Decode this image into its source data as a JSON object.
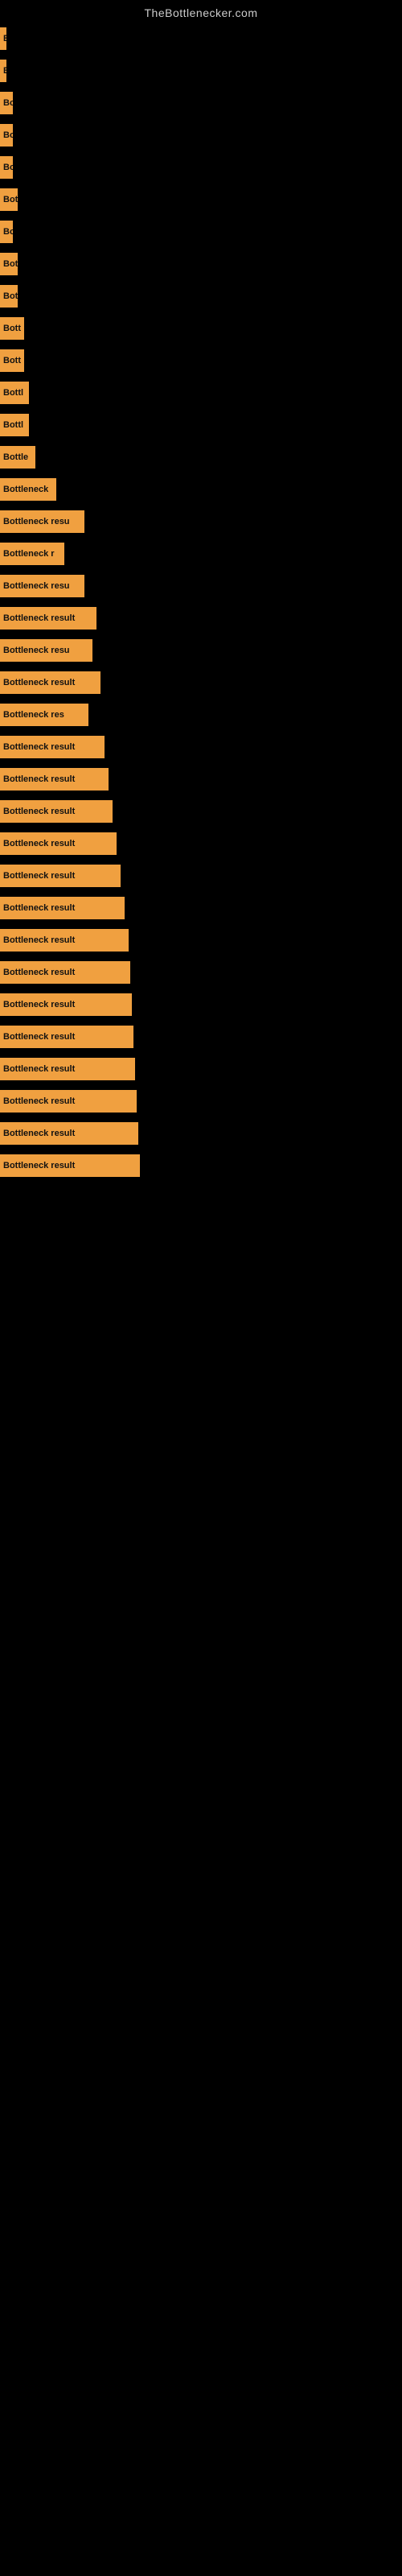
{
  "site_title": "TheBottlenecker.com",
  "bars": [
    {
      "id": 1,
      "label": "B",
      "width": 8
    },
    {
      "id": 2,
      "label": "B",
      "width": 8
    },
    {
      "id": 3,
      "label": "Bo",
      "width": 16
    },
    {
      "id": 4,
      "label": "Bo",
      "width": 16
    },
    {
      "id": 5,
      "label": "Bo",
      "width": 16
    },
    {
      "id": 6,
      "label": "Bot",
      "width": 22
    },
    {
      "id": 7,
      "label": "Bo",
      "width": 16
    },
    {
      "id": 8,
      "label": "Bot",
      "width": 22
    },
    {
      "id": 9,
      "label": "Bot",
      "width": 22
    },
    {
      "id": 10,
      "label": "Bott",
      "width": 30
    },
    {
      "id": 11,
      "label": "Bott",
      "width": 30
    },
    {
      "id": 12,
      "label": "Bottl",
      "width": 36
    },
    {
      "id": 13,
      "label": "Bottl",
      "width": 36
    },
    {
      "id": 14,
      "label": "Bottle",
      "width": 44
    },
    {
      "id": 15,
      "label": "Bottleneck",
      "width": 70
    },
    {
      "id": 16,
      "label": "Bottleneck resu",
      "width": 105
    },
    {
      "id": 17,
      "label": "Bottleneck r",
      "width": 80
    },
    {
      "id": 18,
      "label": "Bottleneck resu",
      "width": 105
    },
    {
      "id": 19,
      "label": "Bottleneck result",
      "width": 120
    },
    {
      "id": 20,
      "label": "Bottleneck resu",
      "width": 115
    },
    {
      "id": 21,
      "label": "Bottleneck result",
      "width": 125
    },
    {
      "id": 22,
      "label": "Bottleneck res",
      "width": 110
    },
    {
      "id": 23,
      "label": "Bottleneck result",
      "width": 130
    },
    {
      "id": 24,
      "label": "Bottleneck result",
      "width": 135
    },
    {
      "id": 25,
      "label": "Bottleneck result",
      "width": 140
    },
    {
      "id": 26,
      "label": "Bottleneck result",
      "width": 145
    },
    {
      "id": 27,
      "label": "Bottleneck result",
      "width": 150
    },
    {
      "id": 28,
      "label": "Bottleneck result",
      "width": 155
    },
    {
      "id": 29,
      "label": "Bottleneck result",
      "width": 160
    },
    {
      "id": 30,
      "label": "Bottleneck result",
      "width": 162
    },
    {
      "id": 31,
      "label": "Bottleneck result",
      "width": 164
    },
    {
      "id": 32,
      "label": "Bottleneck result",
      "width": 166
    },
    {
      "id": 33,
      "label": "Bottleneck result",
      "width": 168
    },
    {
      "id": 34,
      "label": "Bottleneck result",
      "width": 170
    },
    {
      "id": 35,
      "label": "Bottleneck result",
      "width": 172
    },
    {
      "id": 36,
      "label": "Bottleneck result",
      "width": 174
    }
  ]
}
